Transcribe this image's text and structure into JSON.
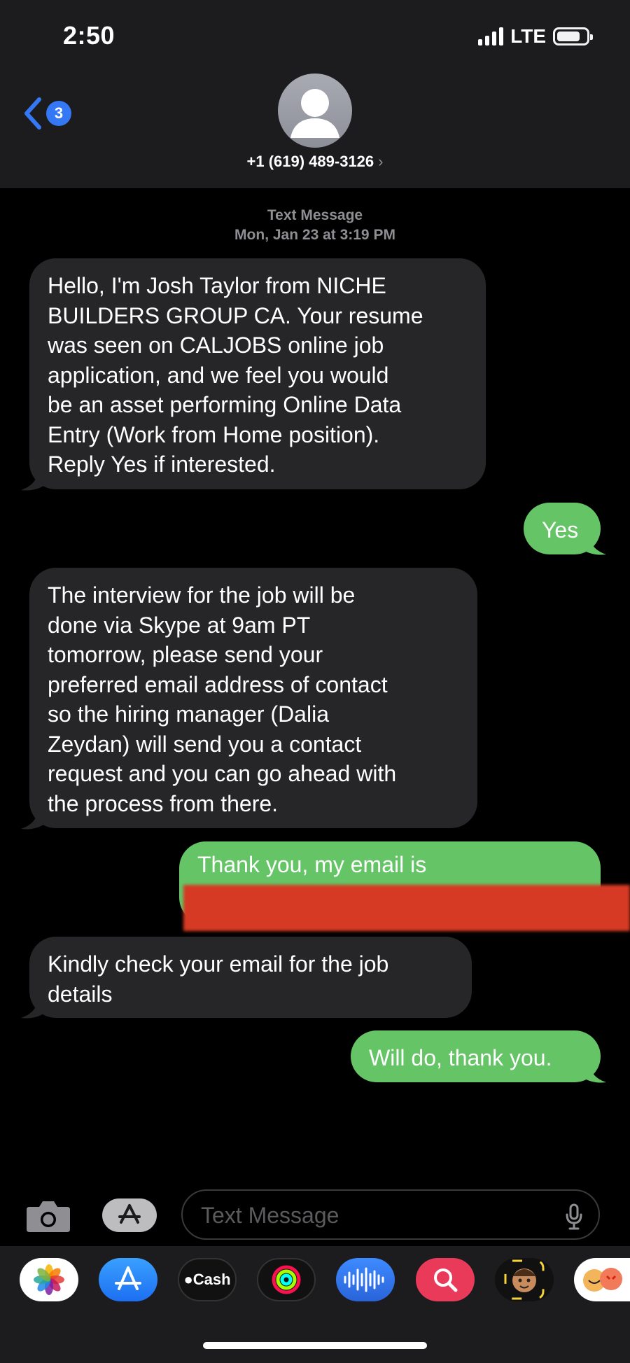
{
  "status_bar": {
    "time": "2:50",
    "network": "LTE",
    "battery_level": 0.8
  },
  "header": {
    "unread_count": "3",
    "contact": "+1 (619) 489-3126",
    "chevron": "›"
  },
  "thread": {
    "service": "Text Message",
    "datetime": "Mon, Jan 23 at 3:19 PM",
    "messages": [
      {
        "from": "them",
        "lines": [
          "Hello, I'm Josh Taylor from NICHE",
          "BUILDERS GROUP CA. Your resume",
          "was seen on CALJOBS online job",
          "application, and we feel you would",
          "be an asset performing Online Data",
          "Entry (Work from Home position).",
          "Reply Yes if interested."
        ]
      },
      {
        "from": "me",
        "lines": [
          "Yes"
        ]
      },
      {
        "from": "them",
        "lines": [
          "The interview for the job will be",
          "done via Skype at 9am PT",
          "tomorrow, please send your",
          "preferred email address of contact",
          "so the hiring manager (Dalia",
          "Zeydan) will send you a contact",
          "request and you can go ahead with",
          "the process from there."
        ]
      },
      {
        "from": "me",
        "lines": [
          "Thank you, my email is"
        ],
        "redacted": true
      },
      {
        "from": "them",
        "lines": [
          "Kindly check your email for the job",
          "details"
        ]
      },
      {
        "from": "me",
        "lines": [
          "Will do, thank you."
        ]
      }
    ]
  },
  "composer": {
    "placeholder": "Text Message"
  },
  "app_drawer": {
    "apps": [
      {
        "icon": "photos-icon"
      },
      {
        "icon": "app-store-icon"
      },
      {
        "icon": "apple-cash-icon",
        "label": "Cash"
      },
      {
        "icon": "activity-icon"
      },
      {
        "icon": "audio-message-icon"
      },
      {
        "icon": "images-search-icon"
      },
      {
        "icon": "memoji-icon"
      },
      {
        "icon": "memoji-stickers-icon"
      }
    ]
  },
  "colors": {
    "incoming_bubble": "#262628",
    "outgoing_bubble": "#65c466",
    "accent": "#3478f6",
    "redaction": "#d63a24"
  }
}
